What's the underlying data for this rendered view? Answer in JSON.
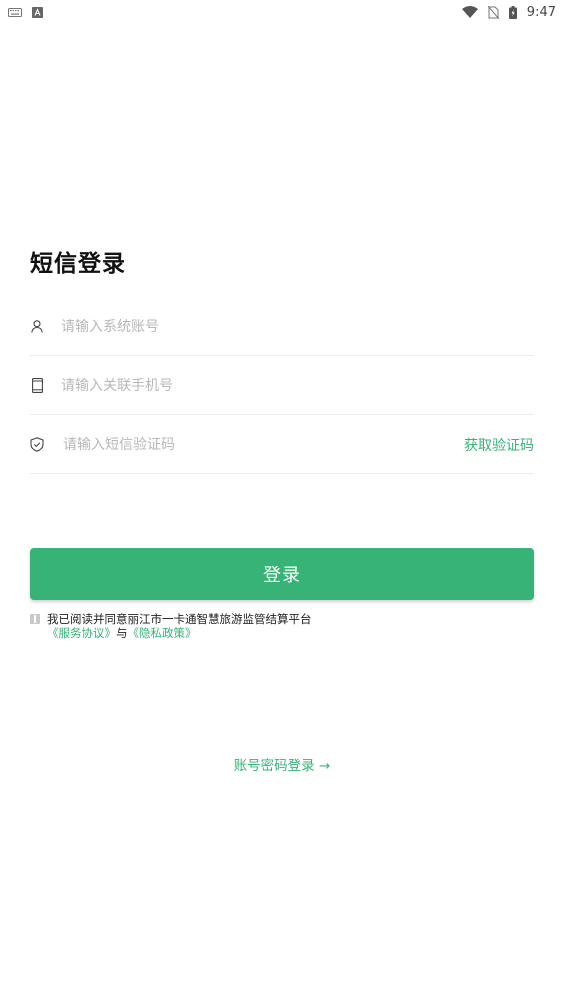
{
  "status_bar": {
    "time": "9:47",
    "left_icons": [
      "keyboard-icon",
      "a-badge-icon"
    ],
    "right_icons": [
      "wifi-icon",
      "no-sim-icon",
      "battery-icon"
    ]
  },
  "page": {
    "title": "短信登录"
  },
  "form": {
    "account": {
      "placeholder": "请输入系统账号",
      "value": "",
      "icon": "user-icon"
    },
    "phone": {
      "placeholder": "请输入关联手机号",
      "value": "",
      "icon": "phone-icon"
    },
    "code": {
      "placeholder": "请输入短信验证码",
      "value": "",
      "icon": "shield-icon",
      "get_code_label": "获取验证码"
    }
  },
  "login_button": {
    "label": "登录"
  },
  "agreement": {
    "text": "我已阅读并同意丽江市一卡通智慧旅游监管结算平台",
    "service_link": "《服务协议》",
    "and_text": "与",
    "privacy_link": "《隐私政策》",
    "checked": false
  },
  "switch_login": {
    "label": "账号密码登录 →"
  },
  "colors": {
    "accent": "#37b377",
    "placeholder": "#b8b8b8",
    "divider": "#ececec"
  }
}
